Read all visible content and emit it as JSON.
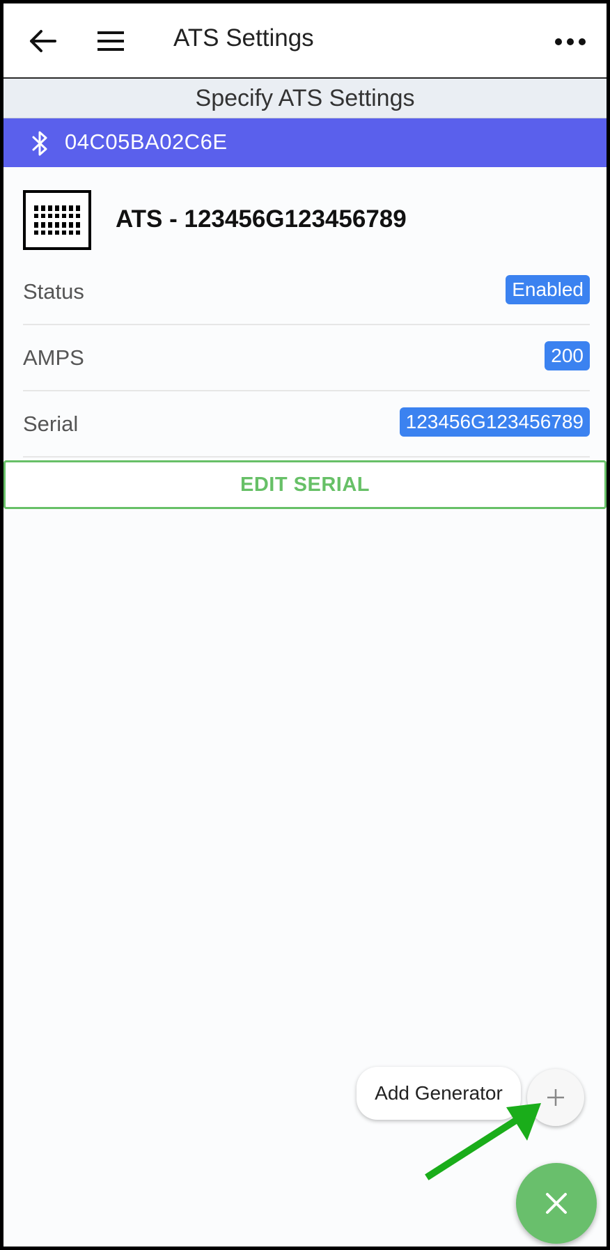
{
  "appbar": {
    "title": "ATS Settings",
    "back_icon": "arrow-left-icon",
    "menu_icon": "hamburger-icon",
    "more_icon": "more-horizontal-icon"
  },
  "subheader": {
    "title": "Specify ATS Settings"
  },
  "bluetooth": {
    "device_id": "04C05BA02C6E",
    "icon": "bluetooth-icon",
    "color": "#5a60ec"
  },
  "device": {
    "title": "ATS - 123456G123456789",
    "icon": "ats-panel-icon"
  },
  "rows": [
    {
      "label": "Status",
      "value": "Enabled"
    },
    {
      "label": "AMPS",
      "value": "200"
    },
    {
      "label": "Serial",
      "value": "123456G123456789"
    }
  ],
  "edit_serial": {
    "label": "EDIT SERIAL",
    "color": "#67c067"
  },
  "fab": {
    "tooltip": "Add Generator",
    "mini_icon": "plus-icon",
    "main_icon": "close-icon",
    "main_color": "#69bf6c"
  },
  "annotation": {
    "icon": "pointer-arrow-icon",
    "color": "#1aad1a"
  }
}
